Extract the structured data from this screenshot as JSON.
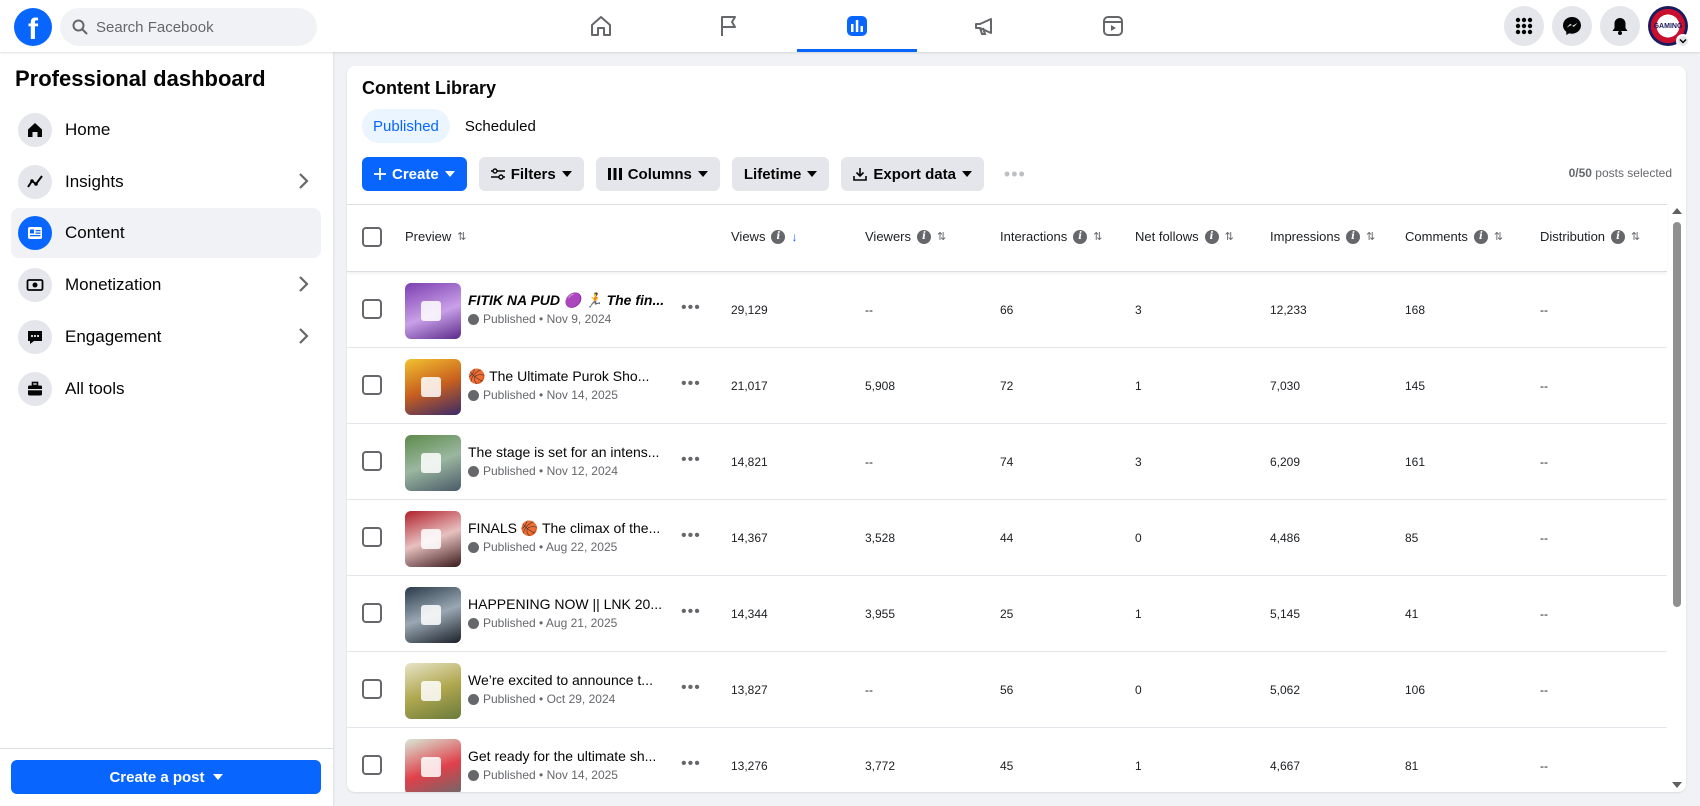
{
  "search": {
    "placeholder": "Search Facebook"
  },
  "nav": {
    "tabs": [
      "home-icon",
      "flag-icon",
      "dashboard-icon",
      "megaphone-icon",
      "reels-icon"
    ],
    "active_index": 2
  },
  "colors": {
    "brand": "#0866ff",
    "background": "#f0f2f5"
  },
  "avatar": {
    "text": "GAMING"
  },
  "sidebar": {
    "title": "Professional dashboard",
    "items": [
      {
        "label": "Home",
        "icon": "home-icon",
        "chevron": false
      },
      {
        "label": "Insights",
        "icon": "insights-icon",
        "chevron": true
      },
      {
        "label": "Content",
        "icon": "content-icon",
        "chevron": false,
        "active": true
      },
      {
        "label": "Monetization",
        "icon": "money-icon",
        "chevron": true
      },
      {
        "label": "Engagement",
        "icon": "chat-icon",
        "chevron": true
      },
      {
        "label": "All tools",
        "icon": "toolbox-icon",
        "chevron": false
      }
    ],
    "create_post_label": "Create a post"
  },
  "library": {
    "title": "Content Library",
    "tabs": [
      "Published",
      "Scheduled"
    ],
    "toolbar": {
      "create": "Create",
      "filters": "Filters",
      "columns": "Columns",
      "lifetime": "Lifetime",
      "export": "Export data"
    },
    "selected_count": "0/50",
    "selected_suffix": " posts selected",
    "columns": [
      "Preview",
      "Views",
      "Viewers",
      "Interactions",
      "Net follows",
      "Impressions",
      "Comments",
      "Distribution"
    ],
    "rows": [
      {
        "title": "FITIK NA PUD 🟣 🏃 The fin...",
        "status": "Published • Nov 9, 2024",
        "views": "29,129",
        "viewers": "--",
        "interactions": "66",
        "net_follows": "3",
        "impressions": "12,233",
        "comments": "168",
        "distribution": "--"
      },
      {
        "title": "🏀 The Ultimate Purok Sho...",
        "status": "Published • Nov 14, 2025",
        "views": "21,017",
        "viewers": "5,908",
        "interactions": "72",
        "net_follows": "1",
        "impressions": "7,030",
        "comments": "145",
        "distribution": "--"
      },
      {
        "title": "The stage is set for an intens...",
        "status": "Published • Nov 12, 2024",
        "views": "14,821",
        "viewers": "--",
        "interactions": "74",
        "net_follows": "3",
        "impressions": "6,209",
        "comments": "161",
        "distribution": "--"
      },
      {
        "title": "FINALS 🏀 The climax of the...",
        "status": "Published • Aug 22, 2025",
        "views": "14,367",
        "viewers": "3,528",
        "interactions": "44",
        "net_follows": "0",
        "impressions": "4,486",
        "comments": "85",
        "distribution": "--"
      },
      {
        "title": "HAPPENING NOW || LNK 20...",
        "status": "Published • Aug 21, 2025",
        "views": "14,344",
        "viewers": "3,955",
        "interactions": "25",
        "net_follows": "1",
        "impressions": "5,145",
        "comments": "41",
        "distribution": "--"
      },
      {
        "title": "We’re excited to announce t...",
        "status": "Published • Oct 29, 2024",
        "views": "13,827",
        "viewers": "--",
        "interactions": "56",
        "net_follows": "0",
        "impressions": "5,062",
        "comments": "106",
        "distribution": "--"
      },
      {
        "title": "Get ready for the ultimate sh...",
        "status": "Published • Nov 14, 2025",
        "views": "13,276",
        "viewers": "3,772",
        "interactions": "45",
        "net_follows": "1",
        "impressions": "4,667",
        "comments": "81",
        "distribution": "--"
      }
    ]
  }
}
